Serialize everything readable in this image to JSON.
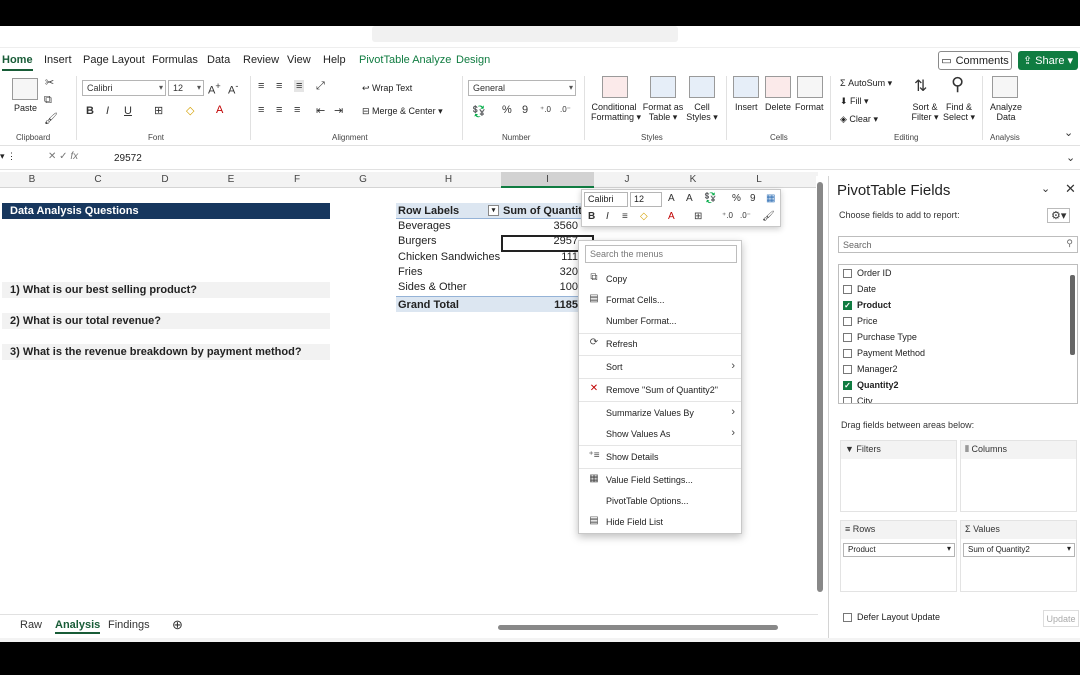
{
  "ribbon_tabs": [
    "Home",
    "Insert",
    "Page Layout",
    "Formulas",
    "Data",
    "Review",
    "View",
    "Help",
    "PivotTable Analyze",
    "Design"
  ],
  "top_buttons": {
    "comments": "Comments",
    "share": "Share"
  },
  "ribbon": {
    "clipboard": {
      "paste": "Paste",
      "label": "Clipboard"
    },
    "font": {
      "name": "Calibri",
      "size": "12",
      "label": "Font"
    },
    "alignment": {
      "wrap": "Wrap Text",
      "merge": "Merge & Center",
      "label": "Alignment"
    },
    "number": {
      "format": "General",
      "label": "Number"
    },
    "styles": {
      "cond1": "Conditional",
      "cond2": "Formatting",
      "fmt1": "Format as",
      "fmt2": "Table",
      "cell1": "Cell",
      "cell2": "Styles",
      "label": "Styles"
    },
    "cells": {
      "insert": "Insert",
      "delete": "Delete",
      "format": "Format",
      "label": "Cells"
    },
    "editing": {
      "autosum": "AutoSum",
      "fill": "Fill",
      "clear": "Clear",
      "sort1": "Sort &",
      "sort2": "Filter",
      "find1": "Find &",
      "find2": "Select",
      "label": "Editing"
    },
    "analysis": {
      "analyze1": "Analyze",
      "analyze2": "Data",
      "label": "Analysis"
    }
  },
  "formula_bar": {
    "fx": "fx",
    "value": "29572"
  },
  "columns": [
    "B",
    "C",
    "D",
    "E",
    "F",
    "G",
    "H",
    "I",
    "J",
    "K",
    "L"
  ],
  "questions": {
    "header": "Data Analysis Questions",
    "q1": "1) What is our best selling product?",
    "q2": "2) What is our total revenue?",
    "q3": "3) What is the revenue breakdown by payment method?"
  },
  "pivot": {
    "row_labels": "Row Labels",
    "sum_header": "Sum of Quantit",
    "rows": [
      {
        "label": "Beverages",
        "value": "3560"
      },
      {
        "label": "Burgers",
        "value": "2957"
      },
      {
        "label": "Chicken Sandwiches",
        "value": "111"
      },
      {
        "label": "Fries",
        "value": "320"
      },
      {
        "label": "Sides & Other",
        "value": "100"
      }
    ],
    "total_label": "Grand Total",
    "total_value": "1185"
  },
  "mini_toolbar": {
    "font": "Calibri",
    "size": "12"
  },
  "context_menu": {
    "search_placeholder": "Search the menus",
    "items": [
      "Copy",
      "Format Cells...",
      "Number Format...",
      "Refresh",
      "Sort",
      "Remove \"Sum of Quantity2\"",
      "Summarize Values By",
      "Show Values As",
      "Show Details",
      "Value Field Settings...",
      "PivotTable Options...",
      "Hide Field List"
    ]
  },
  "sheets": [
    "Raw",
    "Analysis",
    "Findings"
  ],
  "pivot_pane": {
    "title": "PivotTable Fields",
    "subtitle": "Choose fields to add to report:",
    "search_placeholder": "Search",
    "fields": [
      {
        "name": "Order ID",
        "checked": false
      },
      {
        "name": "Date",
        "checked": false
      },
      {
        "name": "Product",
        "checked": true
      },
      {
        "name": "Price",
        "checked": false
      },
      {
        "name": "Purchase Type",
        "checked": false
      },
      {
        "name": "Payment Method",
        "checked": false
      },
      {
        "name": "Manager2",
        "checked": false
      },
      {
        "name": "Quantity2",
        "checked": true
      },
      {
        "name": "City",
        "checked": false
      }
    ],
    "drag_label": "Drag fields between areas below:",
    "areas": {
      "filters": "Filters",
      "columns": "Columns",
      "rows": "Rows",
      "values": "Values"
    },
    "rows_chip": "Product",
    "values_chip": "Sum of Quantity2",
    "defer": "Defer Layout Update",
    "update": "Update"
  },
  "colors": {
    "accent": "#107c41",
    "header_blue": "#17375e",
    "pivot_header": "#dce6f1"
  }
}
